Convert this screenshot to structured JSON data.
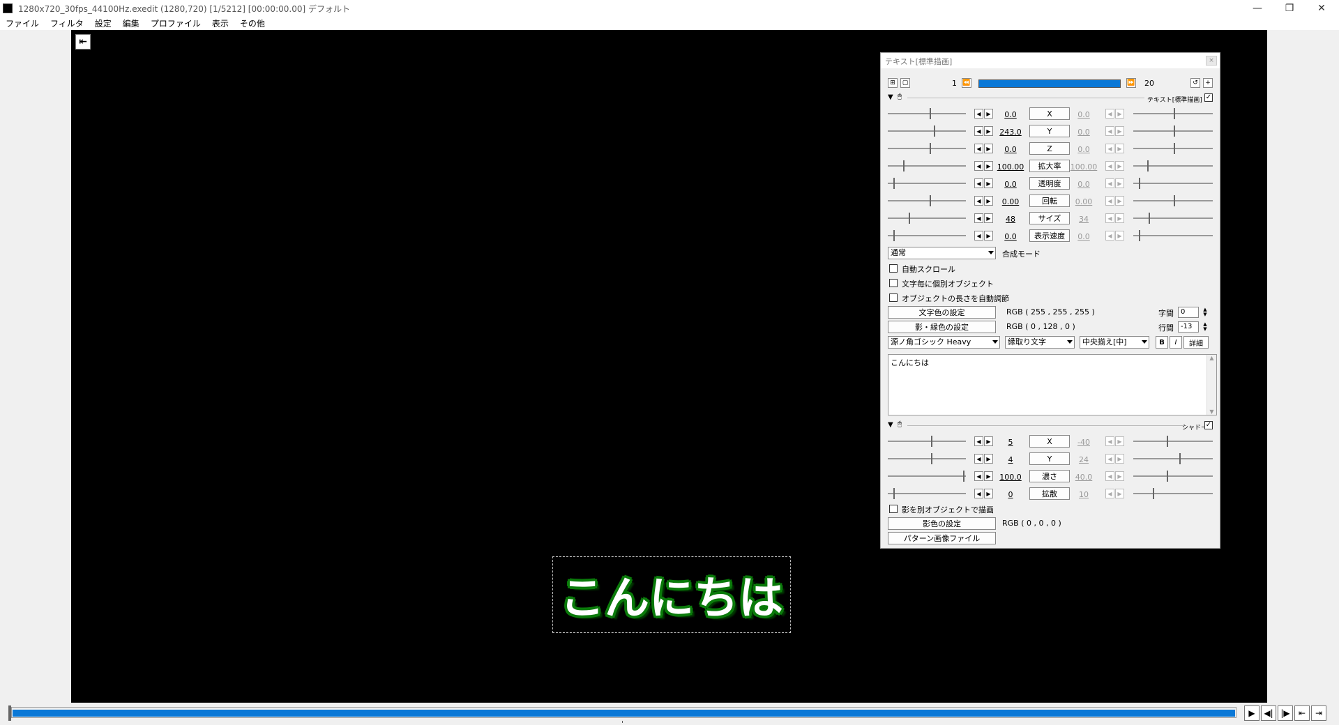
{
  "window": {
    "title": "1280x720_30fps_44100Hz.exedit (1280,720)  [1/5212] [00:00:00.00]  デフォルト",
    "minimize": "—",
    "maximize": "❐",
    "close": "✕"
  },
  "menu": [
    "ファイル",
    "フィルタ",
    "設定",
    "編集",
    "プロファイル",
    "表示",
    "その他"
  ],
  "preview": {
    "home_glyph": "⇤",
    "text_object": "こんにちは"
  },
  "panel": {
    "title": "テキスト[標準描画]",
    "close_glyph": "×",
    "frame_start": "1",
    "frame_end": "20",
    "rewind_glyph": "⏪",
    "forward_glyph": "⏩",
    "text_section": {
      "title": "テキスト[標準描画]",
      "enabled": true,
      "params": [
        {
          "name": "X",
          "left": "0.0",
          "right": "0.0"
        },
        {
          "name": "Y",
          "left": "243.0",
          "right": "0.0"
        },
        {
          "name": "Z",
          "left": "0.0",
          "right": "0.0"
        },
        {
          "name": "拡大率",
          "left": "100.00",
          "right": "100.00"
        },
        {
          "name": "透明度",
          "left": "0.0",
          "right": "0.0"
        },
        {
          "name": "回転",
          "left": "0.00",
          "right": "0.00"
        },
        {
          "name": "サイズ",
          "left": "48",
          "right": "34"
        },
        {
          "name": "表示速度",
          "left": "0.0",
          "right": "0.0"
        }
      ],
      "blend_mode_value": "通常",
      "blend_mode_label": "合成モード",
      "checkboxes": [
        "自動スクロール",
        "文字毎に個別オブジェクト",
        "オブジェクトの長さを自動調節"
      ],
      "text_color_button": "文字色の設定",
      "text_color_value": "RGB ( 255 , 255 , 255 )",
      "shadow_color_button": "影・縁色の設定",
      "shadow_color_value": "RGB ( 0 , 128 , 0 )",
      "char_spacing_label": "字間",
      "char_spacing_value": "0",
      "line_spacing_label": "行間",
      "line_spacing_value": "-13",
      "font": "源ノ角ゴシック Heavy",
      "decoration": "縁取り文字",
      "align": "中央揃え[中]",
      "bold": "B",
      "italic": "I",
      "detail": "詳細",
      "content": "こんにちは"
    },
    "shadow_section": {
      "title": "シャドー",
      "enabled": true,
      "params": [
        {
          "name": "X",
          "left": "5",
          "right": "-40"
        },
        {
          "name": "Y",
          "left": "4",
          "right": "24"
        },
        {
          "name": "濃さ",
          "left": "100.0",
          "right": "40.0"
        },
        {
          "name": "拡散",
          "left": "0",
          "right": "10"
        }
      ],
      "separate_checkbox": "影を別オブジェクトで描画",
      "shadow_color_button": "影色の設定",
      "shadow_color_value": "RGB ( 0 , 0 , 0 )",
      "pattern_button": "パターン画像ファイル"
    }
  },
  "colors": {
    "accent": "#0a78d7",
    "text_fill": "#ffffff",
    "text_edge": "#008000"
  }
}
